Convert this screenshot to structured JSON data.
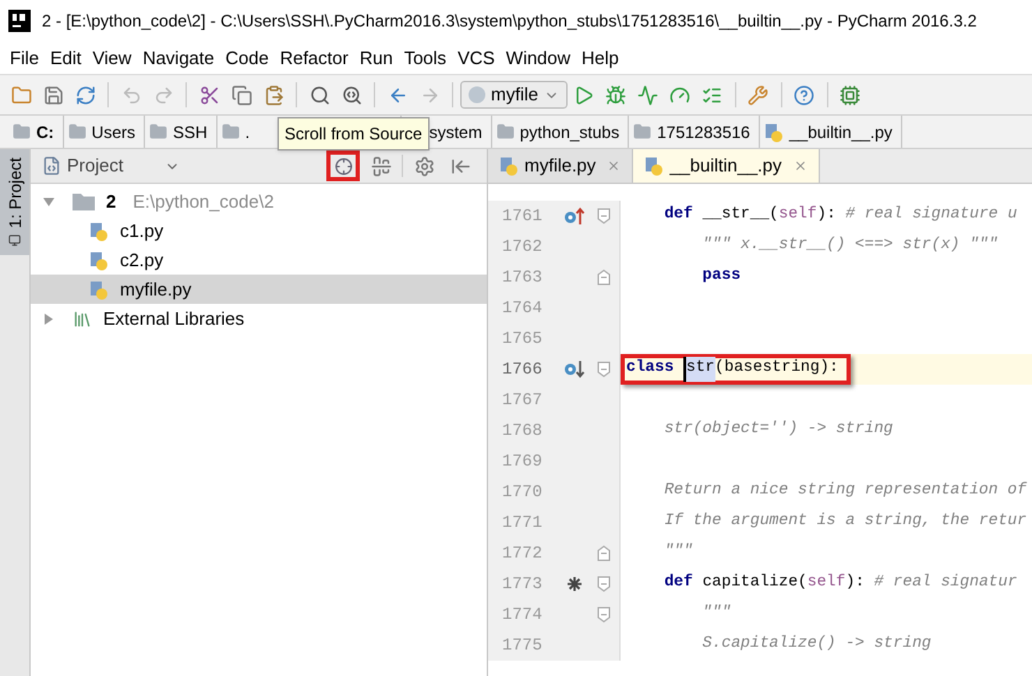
{
  "window": {
    "title": "2 - [E:\\python_code\\2] - C:\\Users\\SSH\\.PyCharm2016.3\\system\\python_stubs\\1751283516\\__builtin__.py - PyCharm 2016.3.2"
  },
  "menu": [
    "File",
    "Edit",
    "View",
    "Navigate",
    "Code",
    "Refactor",
    "Run",
    "Tools",
    "VCS",
    "Window",
    "Help"
  ],
  "toolbar": {
    "run_config": "myfile"
  },
  "breadcrumbs": [
    {
      "label": "C:",
      "kind": "drive"
    },
    {
      "label": "Users",
      "kind": "folder"
    },
    {
      "label": "SSH",
      "kind": "folder"
    },
    {
      "label": ".",
      "kind": "folder"
    },
    {
      "label": "system",
      "kind": "folder"
    },
    {
      "label": "python_stubs",
      "kind": "folder"
    },
    {
      "label": "1751283516",
      "kind": "folder"
    },
    {
      "label": "__builtin__.py",
      "kind": "file"
    }
  ],
  "tooltip": "Scroll from Source",
  "side_strip": {
    "label": "1: Project"
  },
  "project_panel": {
    "title": "Project",
    "scroll_from_source_annotated": true,
    "tree": [
      {
        "label": "2",
        "path": "E:\\python_code\\2",
        "kind": "folder",
        "expanded": true,
        "selected": false,
        "children": [
          {
            "label": "c1.py",
            "kind": "python",
            "selected": false
          },
          {
            "label": "c2.py",
            "kind": "python",
            "selected": false
          },
          {
            "label": "myfile.py",
            "kind": "python",
            "selected": true
          }
        ]
      },
      {
        "label": "External Libraries",
        "kind": "library",
        "expanded": false,
        "selected": false
      }
    ]
  },
  "editor": {
    "tabs": [
      {
        "label": "myfile.py",
        "selected": false
      },
      {
        "label": "__builtin__.py",
        "selected": true
      }
    ],
    "lines": [
      {
        "number": "1761",
        "marker": {
          "kind": "up"
        },
        "fold": {
          "kind": "start"
        },
        "current": false,
        "annotated": false,
        "tokens": [
          {
            "text": "    def",
            "kind": "kw"
          },
          {
            "text": " __str__(",
            "kind": "plain"
          },
          {
            "text": "self",
            "kind": "self"
          },
          {
            "text": "): ",
            "kind": "plain"
          },
          {
            "text": "# real signature u",
            "kind": "comment"
          }
        ]
      },
      {
        "number": "1762",
        "current": false,
        "annotated": false,
        "tokens": [
          {
            "text": "        \"\"\" x.__str__() <==> str(x) \"\"\"",
            "kind": "doc"
          }
        ]
      },
      {
        "number": "1763",
        "fold": {
          "kind": "end"
        },
        "current": false,
        "annotated": false,
        "tokens": [
          {
            "text": "        pass",
            "kind": "kw"
          }
        ]
      },
      {
        "number": "1764",
        "current": false,
        "annotated": false
      },
      {
        "number": "1765",
        "current": false,
        "annotated": false
      },
      {
        "number": "1766",
        "marker": {
          "kind": "down"
        },
        "fold": {
          "kind": "start"
        },
        "current": true,
        "annotated": true,
        "tokens": [
          {
            "text": "class ",
            "kind": "kw"
          },
          {
            "text": "str",
            "kind": "selected"
          },
          {
            "text": "(basestring):",
            "kind": "plain"
          }
        ]
      },
      {
        "number": "1767",
        "current": false,
        "annotated": false
      },
      {
        "number": "1768",
        "current": false,
        "annotated": false,
        "tokens": [
          {
            "text": "    str(object='') -> string",
            "kind": "doc"
          }
        ]
      },
      {
        "number": "1769",
        "current": false,
        "annotated": false
      },
      {
        "number": "1770",
        "current": false,
        "annotated": false,
        "tokens": [
          {
            "text": "    Return a nice string representation of",
            "kind": "doc"
          }
        ]
      },
      {
        "number": "1771",
        "current": false,
        "annotated": false,
        "tokens": [
          {
            "text": "    If the argument is a string, the retur",
            "kind": "doc"
          }
        ]
      },
      {
        "number": "1772",
        "fold": {
          "kind": "end"
        },
        "current": false,
        "annotated": false,
        "tokens": [
          {
            "text": "    \"\"\"",
            "kind": "doc"
          }
        ]
      },
      {
        "number": "1773",
        "marker": {
          "kind": "star"
        },
        "fold": {
          "kind": "start"
        },
        "current": false,
        "annotated": false,
        "tokens": [
          {
            "text": "    def",
            "kind": "kw"
          },
          {
            "text": " capitalize(",
            "kind": "plain"
          },
          {
            "text": "self",
            "kind": "self"
          },
          {
            "text": "): ",
            "kind": "plain"
          },
          {
            "text": "# real signatur",
            "kind": "comment"
          }
        ]
      },
      {
        "number": "1774",
        "fold": {
          "kind": "start"
        },
        "current": false,
        "annotated": false,
        "tokens": [
          {
            "text": "        \"\"\"",
            "kind": "doc"
          }
        ]
      },
      {
        "number": "1775",
        "current": false,
        "annotated": false,
        "tokens": [
          {
            "text": "        S.capitalize() -> string",
            "kind": "doc"
          }
        ]
      }
    ]
  }
}
